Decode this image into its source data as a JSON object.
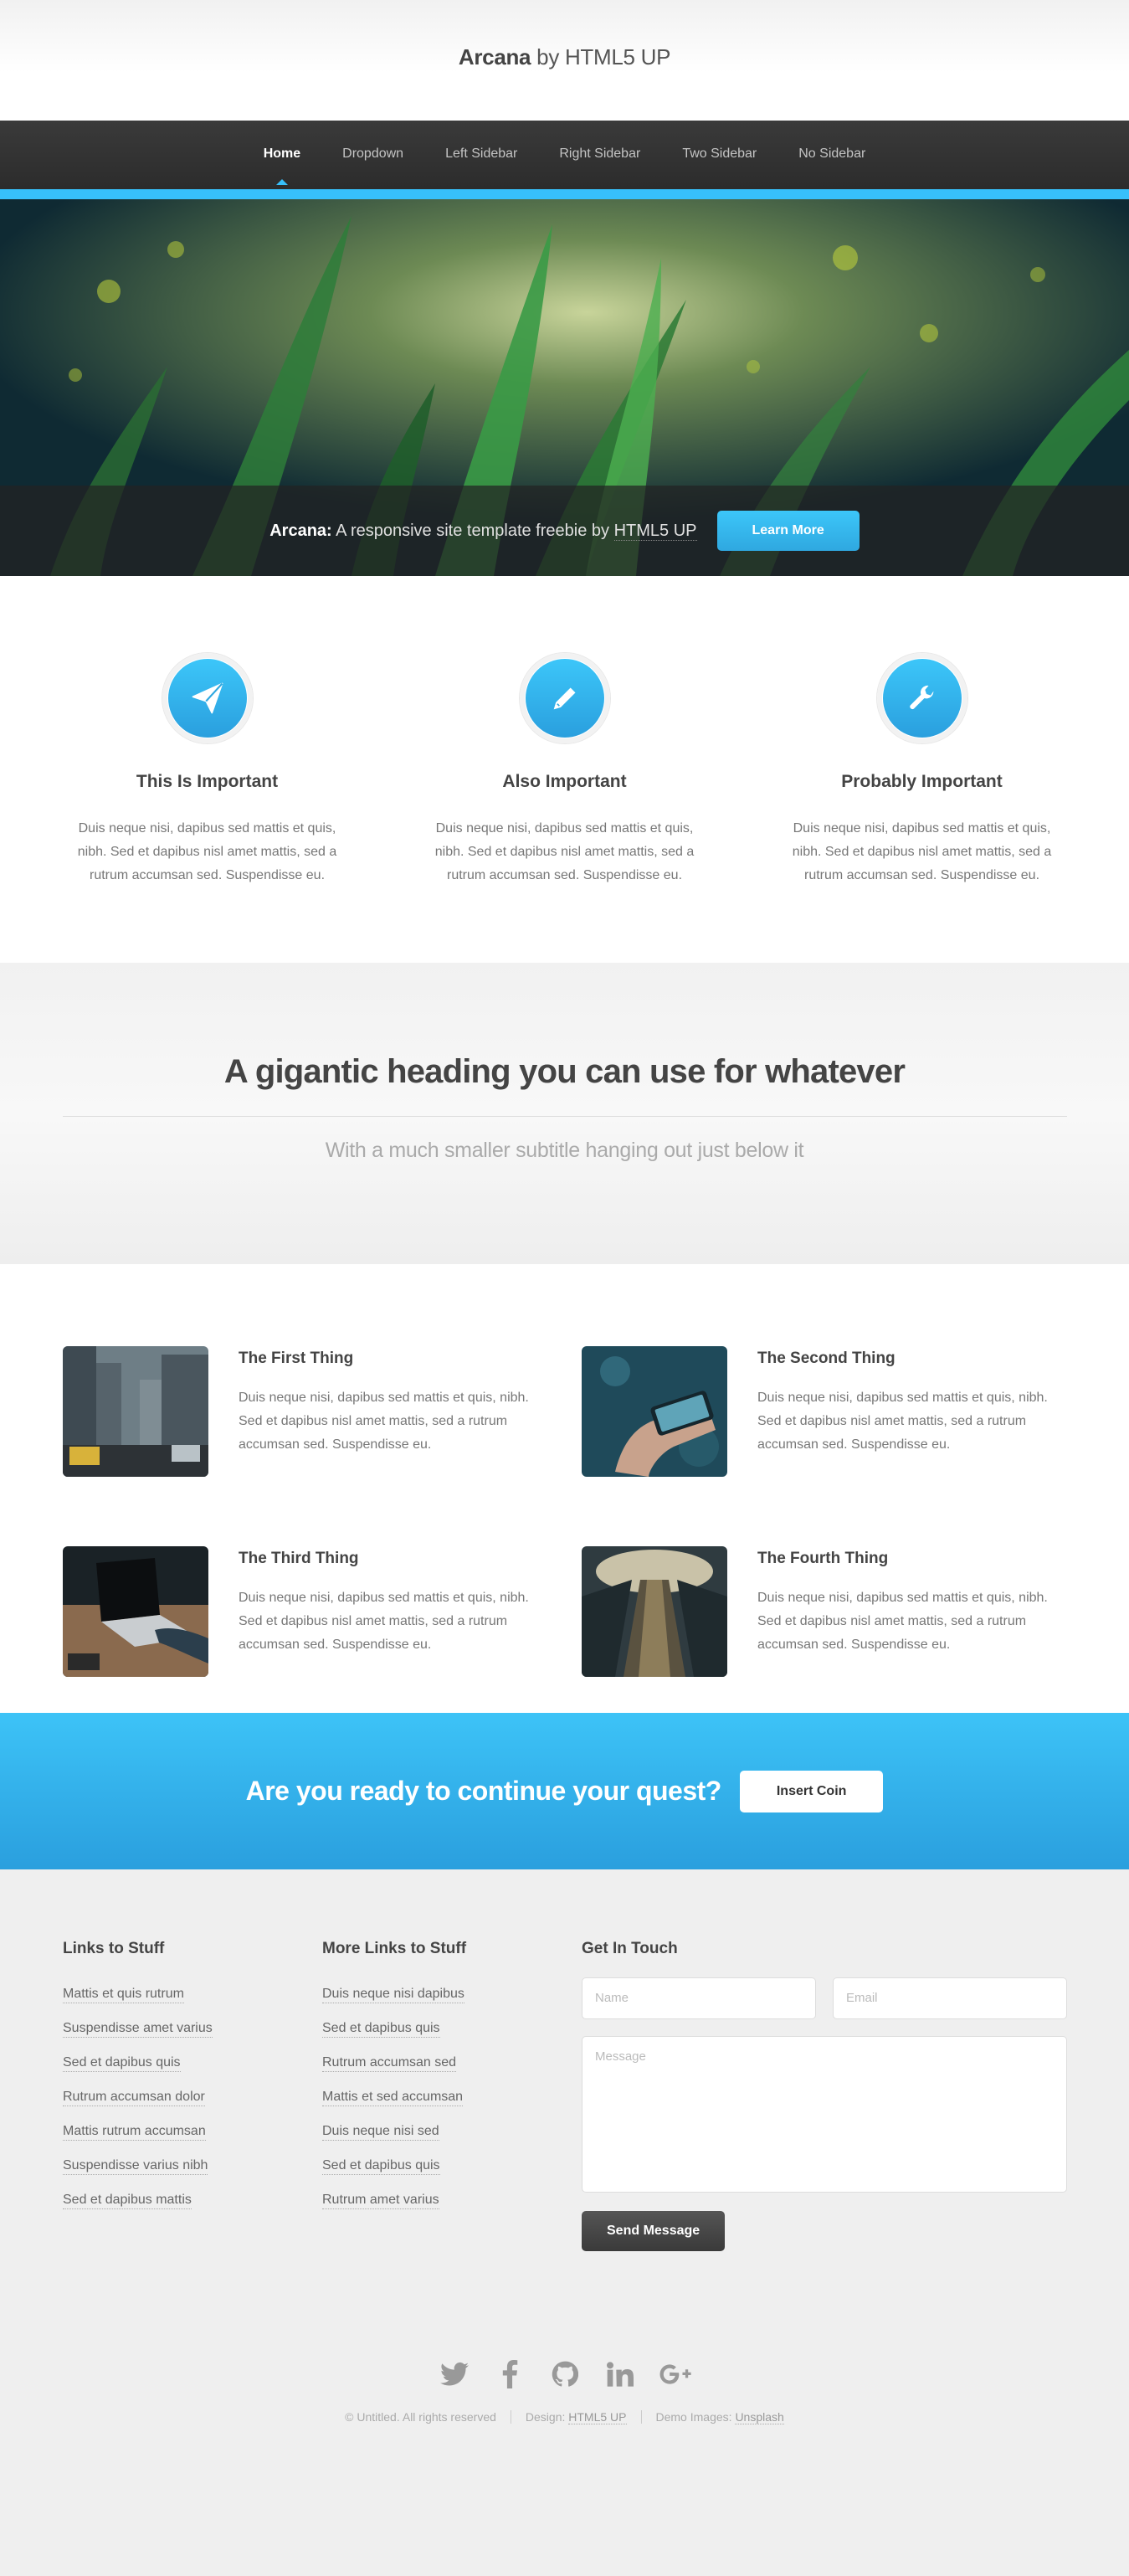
{
  "header": {
    "brand": "Arcana",
    "brand_suffix": "by HTML5 UP"
  },
  "nav": {
    "items": [
      {
        "label": "Home",
        "active": true
      },
      {
        "label": "Dropdown"
      },
      {
        "label": "Left Sidebar"
      },
      {
        "label": "Right Sidebar"
      },
      {
        "label": "Two Sidebar"
      },
      {
        "label": "No Sidebar"
      }
    ]
  },
  "banner": {
    "brand": "Arcana:",
    "text": "A responsive site template freebie by",
    "link": "HTML5 UP",
    "button": "Learn More"
  },
  "features": [
    {
      "icon": "paper-plane-icon",
      "title": "This Is Important",
      "text": "Duis neque nisi, dapibus sed mattis et quis, nibh. Sed et dapibus nisl amet mattis, sed a rutrum accumsan sed. Suspendisse eu."
    },
    {
      "icon": "pencil-icon",
      "title": "Also Important",
      "text": "Duis neque nisi, dapibus sed mattis et quis, nibh. Sed et dapibus nisl amet mattis, sed a rutrum accumsan sed. Suspendisse eu."
    },
    {
      "icon": "wrench-icon",
      "title": "Probably Important",
      "text": "Duis neque nisi, dapibus sed mattis et quis, nibh. Sed et dapibus nisl amet mattis, sed a rutrum accumsan sed. Suspendisse eu."
    }
  ],
  "gigantic": {
    "heading": "A gigantic heading you can use for whatever",
    "subtitle": "With a much smaller subtitle hanging out just below it"
  },
  "things": [
    {
      "title": "The First Thing",
      "text": "Duis neque nisi, dapibus sed mattis et quis, nibh. Sed et dapibus nisl amet mattis, sed a rutrum accumsan sed. Suspendisse eu."
    },
    {
      "title": "The Second Thing",
      "text": "Duis neque nisi, dapibus sed mattis et quis, nibh. Sed et dapibus nisl amet mattis, sed a rutrum accumsan sed. Suspendisse eu."
    },
    {
      "title": "The Third Thing",
      "text": "Duis neque nisi, dapibus sed mattis et quis, nibh. Sed et dapibus nisl amet mattis, sed a rutrum accumsan sed. Suspendisse eu."
    },
    {
      "title": "The Fourth Thing",
      "text": "Duis neque nisi, dapibus sed mattis et quis, nibh. Sed et dapibus nisl amet mattis, sed a rutrum accumsan sed. Suspendisse eu."
    }
  ],
  "cta": {
    "heading": "Are you ready to continue your quest?",
    "button": "Insert Coin"
  },
  "footer": {
    "col1": {
      "title": "Links to Stuff",
      "links": [
        "Mattis et quis rutrum",
        "Suspendisse amet varius",
        "Sed et dapibus quis",
        "Rutrum accumsan dolor",
        "Mattis rutrum accumsan",
        "Suspendisse varius nibh",
        "Sed et dapibus mattis"
      ]
    },
    "col2": {
      "title": "More Links to Stuff",
      "links": [
        "Duis neque nisi dapibus",
        "Sed et dapibus quis",
        "Rutrum accumsan sed",
        "Mattis et sed accumsan",
        "Duis neque nisi sed",
        "Sed et dapibus quis",
        "Rutrum amet varius"
      ]
    },
    "contact": {
      "title": "Get In Touch",
      "name_placeholder": "Name",
      "email_placeholder": "Email",
      "message_placeholder": "Message",
      "button": "Send Message"
    },
    "social": [
      "twitter-icon",
      "facebook-icon",
      "github-icon",
      "linkedin-icon",
      "google-plus-icon"
    ],
    "copyright": "© Untitled. All rights reserved",
    "design_label": "Design:",
    "design_link": "HTML5 UP",
    "images_label": "Demo Images:",
    "images_link": "Unsplash"
  },
  "colors": {
    "accent": "#37c0fb",
    "nav_bg": "#2e2e2e",
    "footer_bg": "#efefef"
  }
}
